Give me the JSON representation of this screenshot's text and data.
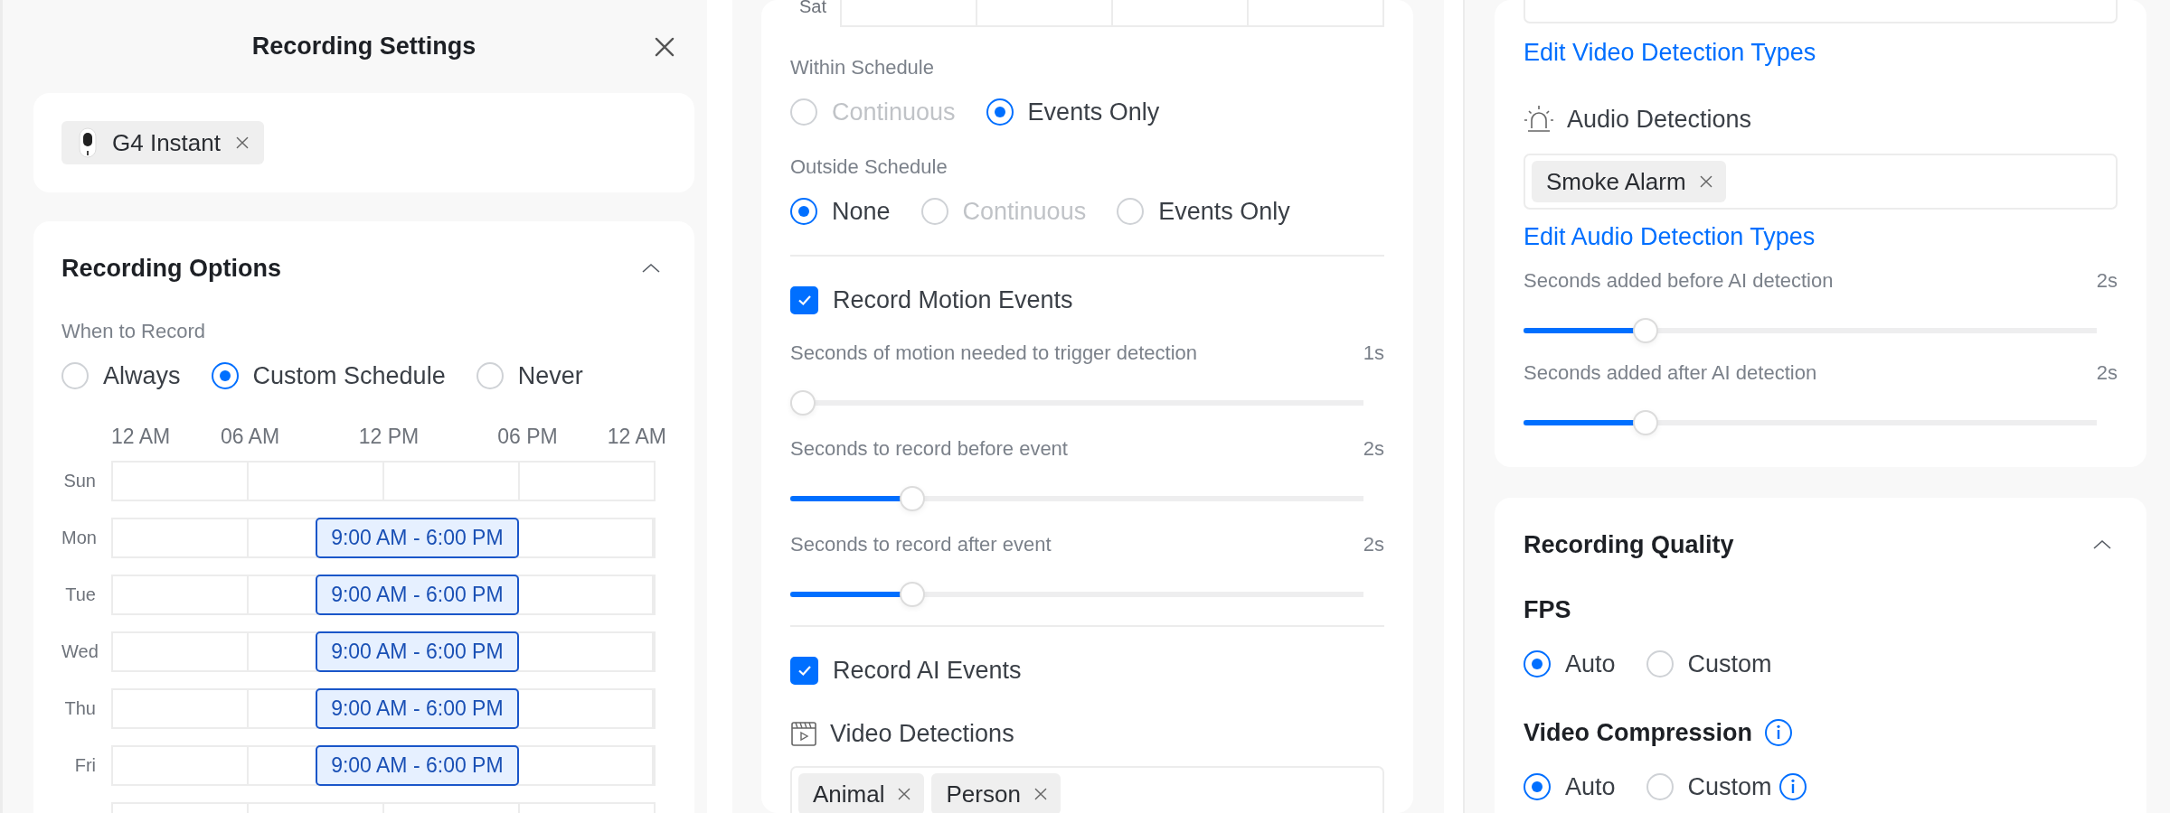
{
  "panel_1": {
    "title": "Recording Settings",
    "devices": [
      {
        "name": "G4 Instant"
      }
    ],
    "recording_options": {
      "title": "Recording Options",
      "expanded": true,
      "when_label": "When to Record",
      "when_options": [
        {
          "label": "Always",
          "selected": false
        },
        {
          "label": "Custom Schedule",
          "selected": true
        },
        {
          "label": "Never",
          "selected": false
        }
      ],
      "time_labels": [
        "12 AM",
        "06 AM",
        "12 PM",
        "06 PM",
        "12 AM"
      ],
      "days": [
        {
          "day": "Sun"
        },
        {
          "day": "Mon",
          "blocks": [
            {
              "label": "9:00 AM - 6:00 PM"
            }
          ]
        },
        {
          "day": "Tue",
          "blocks": [
            {
              "label": "9:00 AM - 6:00 PM"
            }
          ]
        },
        {
          "day": "Wed",
          "blocks": [
            {
              "label": "9:00 AM - 6:00 PM"
            }
          ]
        },
        {
          "day": "Thu",
          "blocks": [
            {
              "label": "9:00 AM - 6:00 PM"
            }
          ]
        },
        {
          "day": "Fri",
          "blocks": [
            {
              "label": "9:00 AM - 6:00 PM"
            }
          ]
        }
      ]
    }
  },
  "panel_2": {
    "days": [
      {
        "day": "Sat"
      }
    ],
    "within_schedule": {
      "label": "Within Schedule",
      "options": [
        {
          "label": "Continuous",
          "selected": false,
          "disabled": true
        },
        {
          "label": "Events Only",
          "selected": true,
          "disabled": false
        }
      ]
    },
    "outside_schedule": {
      "label": "Outside Schedule",
      "options": [
        {
          "label": "None",
          "selected": true,
          "disabled": false
        },
        {
          "label": "Continuous",
          "selected": false,
          "disabled": true
        },
        {
          "label": "Events Only",
          "selected": false,
          "disabled": false
        }
      ]
    },
    "motion_events": {
      "label": "Record Motion Events",
      "checked": true,
      "sliders": [
        {
          "label": "Seconds of motion needed to trigger detection",
          "value": "1s",
          "level": 0
        },
        {
          "label": "Seconds to record before event",
          "value": "2s",
          "level": 0.2
        },
        {
          "label": "Seconds to record after event",
          "value": "2s",
          "level": 0.2
        }
      ]
    },
    "ai_events": {
      "label": "Record AI Events",
      "checked": true,
      "video_detections": {
        "label": "Video Detections",
        "tags": [
          "Animal",
          "Person"
        ]
      }
    }
  },
  "panel_3": {
    "edit_video_link": "Edit Video Detection Types",
    "audio_detections": {
      "label": "Audio Detections",
      "tags": [
        "Smoke Alarm"
      ]
    },
    "edit_audio_link": "Edit Audio Detection Types",
    "sliders": [
      {
        "label": "Seconds added before AI detection",
        "value": "2s",
        "level": 0.2
      },
      {
        "label": "Seconds added after AI detection",
        "value": "2s",
        "level": 0.2
      }
    ],
    "recording_quality": {
      "title": "Recording Quality",
      "expanded": true,
      "fps": {
        "label": "FPS",
        "info": false,
        "options": [
          {
            "label": "Auto",
            "selected": true,
            "info": false
          },
          {
            "label": "Custom",
            "selected": false,
            "info": false
          }
        ]
      },
      "video_compression": {
        "label": "Video Compression",
        "info": true,
        "options": [
          {
            "label": "Auto",
            "selected": true,
            "info": false
          },
          {
            "label": "Custom",
            "selected": false,
            "info": true
          }
        ]
      }
    }
  }
}
